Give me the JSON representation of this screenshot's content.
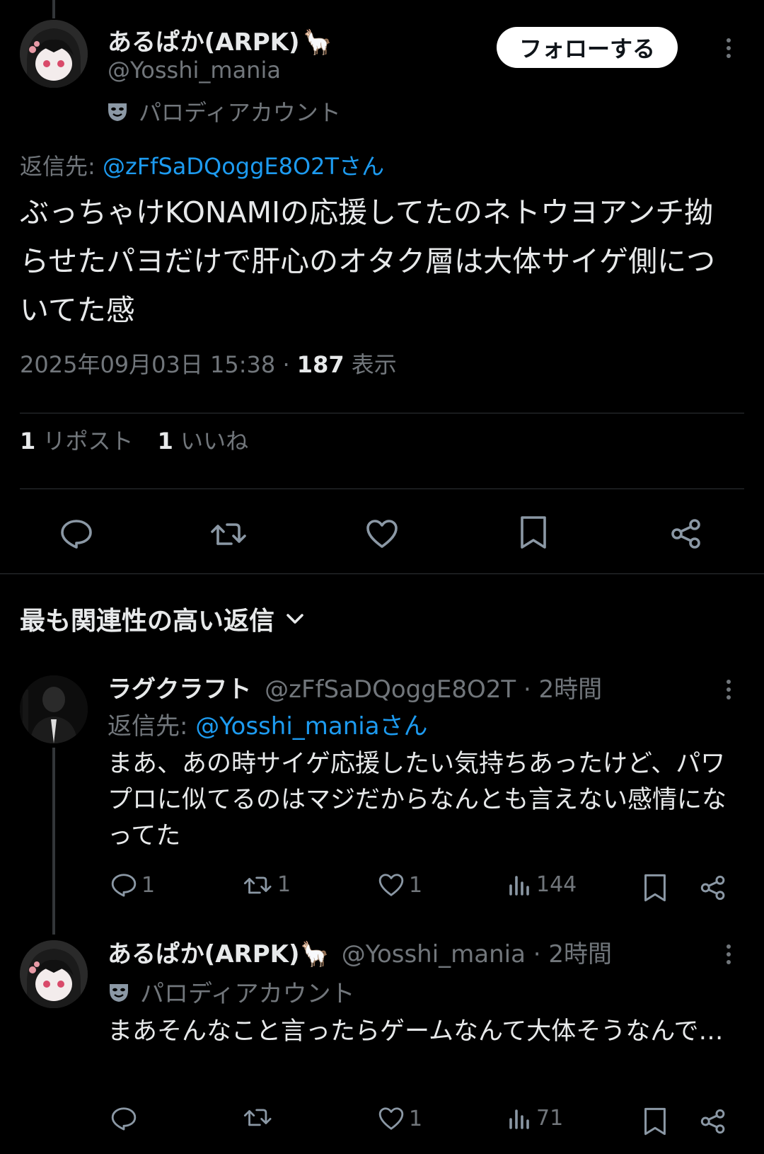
{
  "main_tweet": {
    "display_name": "あるぱか(ARPK)",
    "display_emoji": "🦙",
    "handle": "@Yosshi_mania",
    "parody_label": "パロディアカウント",
    "follow_label": "フォローする",
    "reply_to_prefix": "返信先:",
    "reply_to_handle": "@zFfSaDQoggE8O2Tさん",
    "text": "ぶっちゃけKONAMIの応援してたのネトウヨアンチ拗らせたパヨだけで肝心のオタク層は大体サイゲ側についてた感",
    "timestamp": "2025年09月03日 15:38",
    "dot": "·",
    "views_count": "187",
    "views_label": "表示",
    "reposts_count": "1",
    "reposts_label": "リポスト",
    "likes_count": "1",
    "likes_label": "いいね"
  },
  "replies_header": {
    "label": "最も関連性の高い返信"
  },
  "replies": [
    {
      "display_name": "ラグクラフト",
      "handle": "@zFfSaDQoggE8O2T",
      "time": "· 2時間",
      "reply_to_prefix": "返信先:",
      "reply_to_handle": "@Yosshi_maniaさん",
      "text": "まあ、あの時サイゲ応援したい気持ちあったけど、パワプロに似てるのはマジだからなんとも言えない感情になってた",
      "reply_count": "1",
      "repost_count": "1",
      "like_count": "1",
      "view_count": "144"
    },
    {
      "display_name": "あるぱか(ARPK)",
      "display_emoji": "🦙",
      "handle": "@Yosshi_mania",
      "time": "· 2時間",
      "parody_label": "パロディアカウント",
      "text": "まあそんなこと言ったらゲームなんて大体そうなんで…",
      "reply_count": "",
      "repost_count": "",
      "like_count": "1",
      "view_count": "71"
    }
  ],
  "colors": {
    "background": "#000000",
    "text": "#e7e9ea",
    "muted": "#71767b",
    "link": "#1d9bf0",
    "divider": "#2f3336"
  }
}
